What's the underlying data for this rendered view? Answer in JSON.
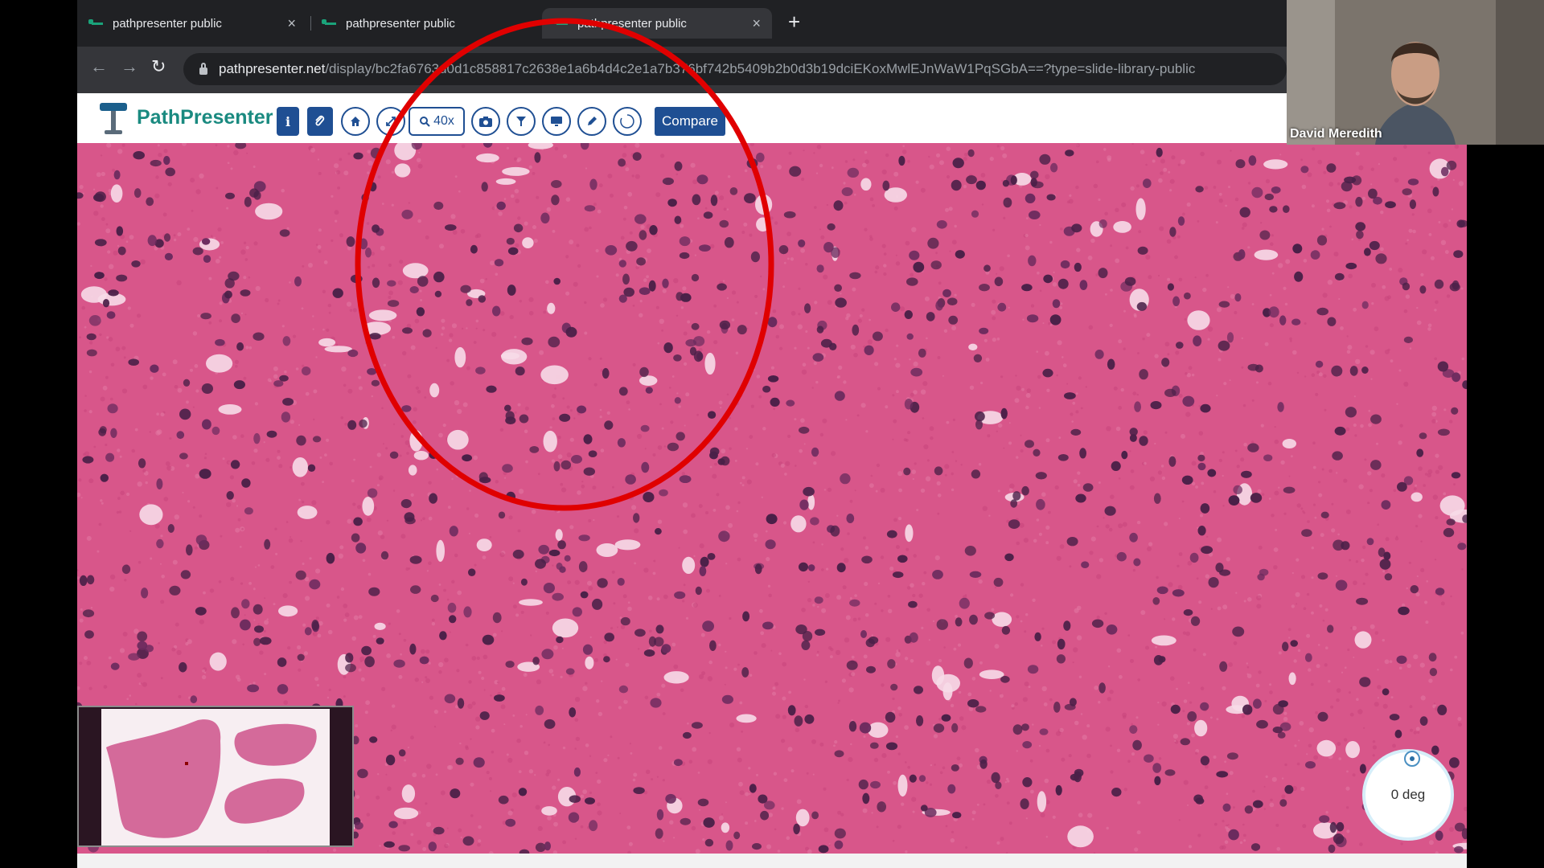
{
  "browser": {
    "tabs": [
      {
        "label": "pathpresenter public",
        "active": false
      },
      {
        "label": "pathpresenter public",
        "active": false
      },
      {
        "label": "pathpresenter public",
        "active": true
      }
    ],
    "new_tab_icon": "plus-icon",
    "url_host": "pathpresenter.net",
    "url_path": "/display/bc2fa6763d0d1c858817c2638e1a6b4d4c2e1a7b376bf742b5409b2b0d3b19dciEKoxMwlEJnWaW1PqSGbA==?type=slide-library-public"
  },
  "app": {
    "logo_text": "PathPresenter",
    "toolbar": {
      "info_icon": "info-icon",
      "attach_icon": "paperclip-icon",
      "home_icon": "home-icon",
      "expand_icon": "expand-icon",
      "zoom_label": "40x",
      "camera_icon": "camera-icon",
      "filter_icon": "filter-icon",
      "monitor_icon": "monitor-icon",
      "pen_icon": "pen-icon",
      "rotate_icon": "rotate-icon",
      "compare_label": "Compare"
    },
    "accent_color": "#1f4f93",
    "rotation_label": "0 deg"
  },
  "annotation": {
    "shape": "ellipse",
    "color": "#e00000"
  },
  "webcam": {
    "participant_name": "David Meredith"
  }
}
